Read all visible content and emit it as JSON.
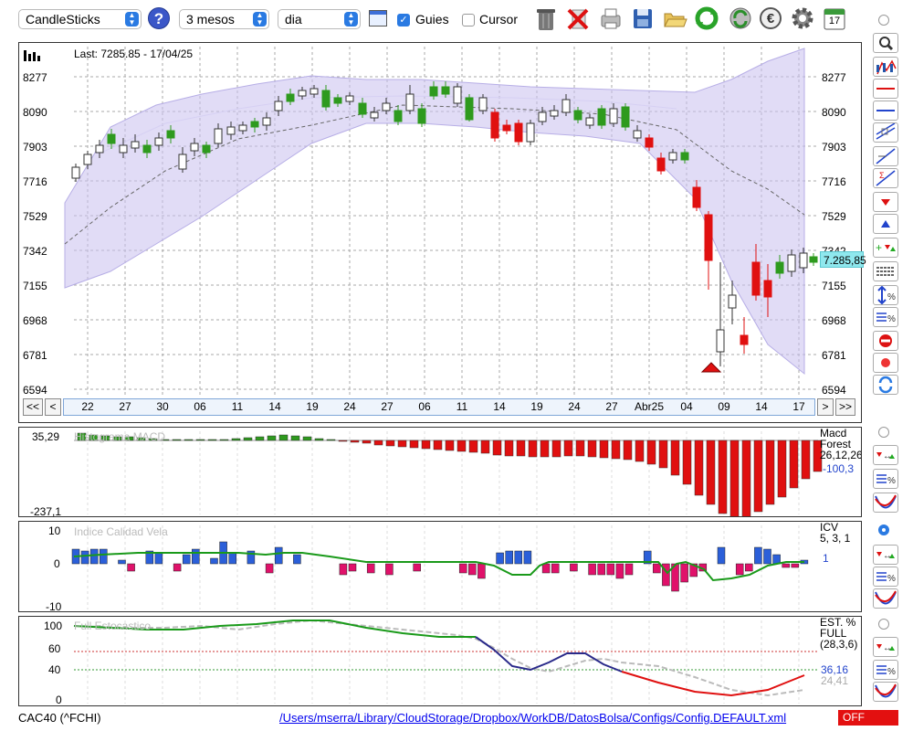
{
  "toolbar": {
    "chart_type": "CandleSticks",
    "period": "3 mesos",
    "interval": "dia",
    "guides_label": "Guies",
    "guides_checked": true,
    "cursor_label": "Cursor",
    "cursor_checked": false,
    "calendar_day": "17"
  },
  "main_chart": {
    "last_label": "Last: 7285.85 - 17/04/25",
    "price_ticks": [
      "8277",
      "8090",
      "7903",
      "7716",
      "7529",
      "7342",
      "7155",
      "6968",
      "6781",
      "6594"
    ],
    "last_price_badge": "7.285,85",
    "date_ticks": [
      "22",
      "27",
      "30",
      "06",
      "11",
      "14",
      "19",
      "24",
      "27",
      "06",
      "11",
      "14",
      "19",
      "24",
      "27",
      "Abr25",
      "04",
      "09",
      "14",
      "17"
    ],
    "nav": {
      "first": "<<",
      "prev": "<",
      "next": ">",
      "last": ">>"
    }
  },
  "macd_panel": {
    "watermark": "Histograma MACD",
    "ticks": [
      "35,29",
      "-237,1"
    ],
    "name": "Macd",
    "sub": "Forest",
    "params": "26,12,26",
    "value": "-100,3"
  },
  "icv_panel": {
    "watermark": "Indice Calidad Vela",
    "ticks": [
      "10",
      "0",
      "-10"
    ],
    "name": "ICV",
    "params": "5, 3, 1",
    "value": "1"
  },
  "stoch_panel": {
    "watermark": "Full Estocastico",
    "ticks": [
      "100",
      "60",
      "40",
      "0"
    ],
    "name": "EST. %",
    "sub": "FULL",
    "params": "(28,3,6)",
    "value_k": "36,16",
    "value_d": "24,41"
  },
  "status": {
    "symbol": "CAC40 (^FCHI)",
    "config_path": "/Users/mserra/Library/CloudStorage/Dropbox/WorkDB/DatosBolsa/Configs/Config.DEFAULT.xml",
    "off_label": "OFF"
  },
  "colors": {
    "up": "#2e9a1e",
    "down": "#e01010",
    "band": "#c9c0ee",
    "link": "#0000ee",
    "badge": "#8fe8ee"
  }
}
